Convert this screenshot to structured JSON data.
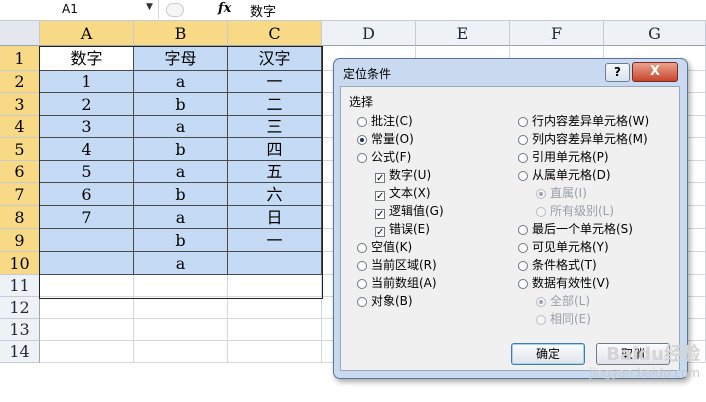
{
  "formula_bar": {
    "name_box": "A1",
    "fx_label": "fx",
    "content": "数字"
  },
  "columns": [
    "A",
    "B",
    "C",
    "D",
    "E",
    "F",
    "G"
  ],
  "rows": [
    "1",
    "2",
    "3",
    "4",
    "5",
    "6",
    "7",
    "8",
    "9",
    "10",
    "11",
    "12",
    "13",
    "14"
  ],
  "cells": [
    [
      "数字",
      "字母",
      "汉字"
    ],
    [
      "1",
      "a",
      "一"
    ],
    [
      "2",
      "b",
      "二"
    ],
    [
      "3",
      "a",
      "三"
    ],
    [
      "4",
      "b",
      "四"
    ],
    [
      "5",
      "a",
      "五"
    ],
    [
      "6",
      "b",
      "六"
    ],
    [
      "7",
      "a",
      "日"
    ],
    [
      "",
      "b",
      "一"
    ],
    [
      "",
      "a",
      ""
    ]
  ],
  "dialog": {
    "title": "定位条件",
    "help": "?",
    "close": "X",
    "group_label": "选择",
    "left_options": [
      "批注(C)",
      "常量(O)",
      "公式(F)"
    ],
    "formula_sub": [
      "数字(U)",
      "文本(X)",
      "逻辑值(G)",
      "错误(E)"
    ],
    "left_options2": [
      "空值(K)",
      "当前区域(R)",
      "当前数组(A)",
      "对象(B)"
    ],
    "right_options": [
      "行内容差异单元格(W)",
      "列内容差异单元格(M)",
      "引用单元格(P)",
      "从属单元格(D)"
    ],
    "dependent_sub": [
      "直属(I)",
      "所有级别(L)"
    ],
    "right_options2": [
      "最后一个单元格(S)",
      "可见单元格(Y)",
      "条件格式(T)",
      "数据有效性(V)"
    ],
    "validation_sub": [
      "全部(L)",
      "相同(E)"
    ],
    "ok": "确定",
    "cancel": "取消"
  },
  "watermark": {
    "line1": "Baidu经验",
    "line2": "jingyan.baidu.com"
  },
  "colors": {
    "selection_fill": "#c5dbf5",
    "header_selected": "#f8d985",
    "dialog_frame": "#c9daf0"
  }
}
